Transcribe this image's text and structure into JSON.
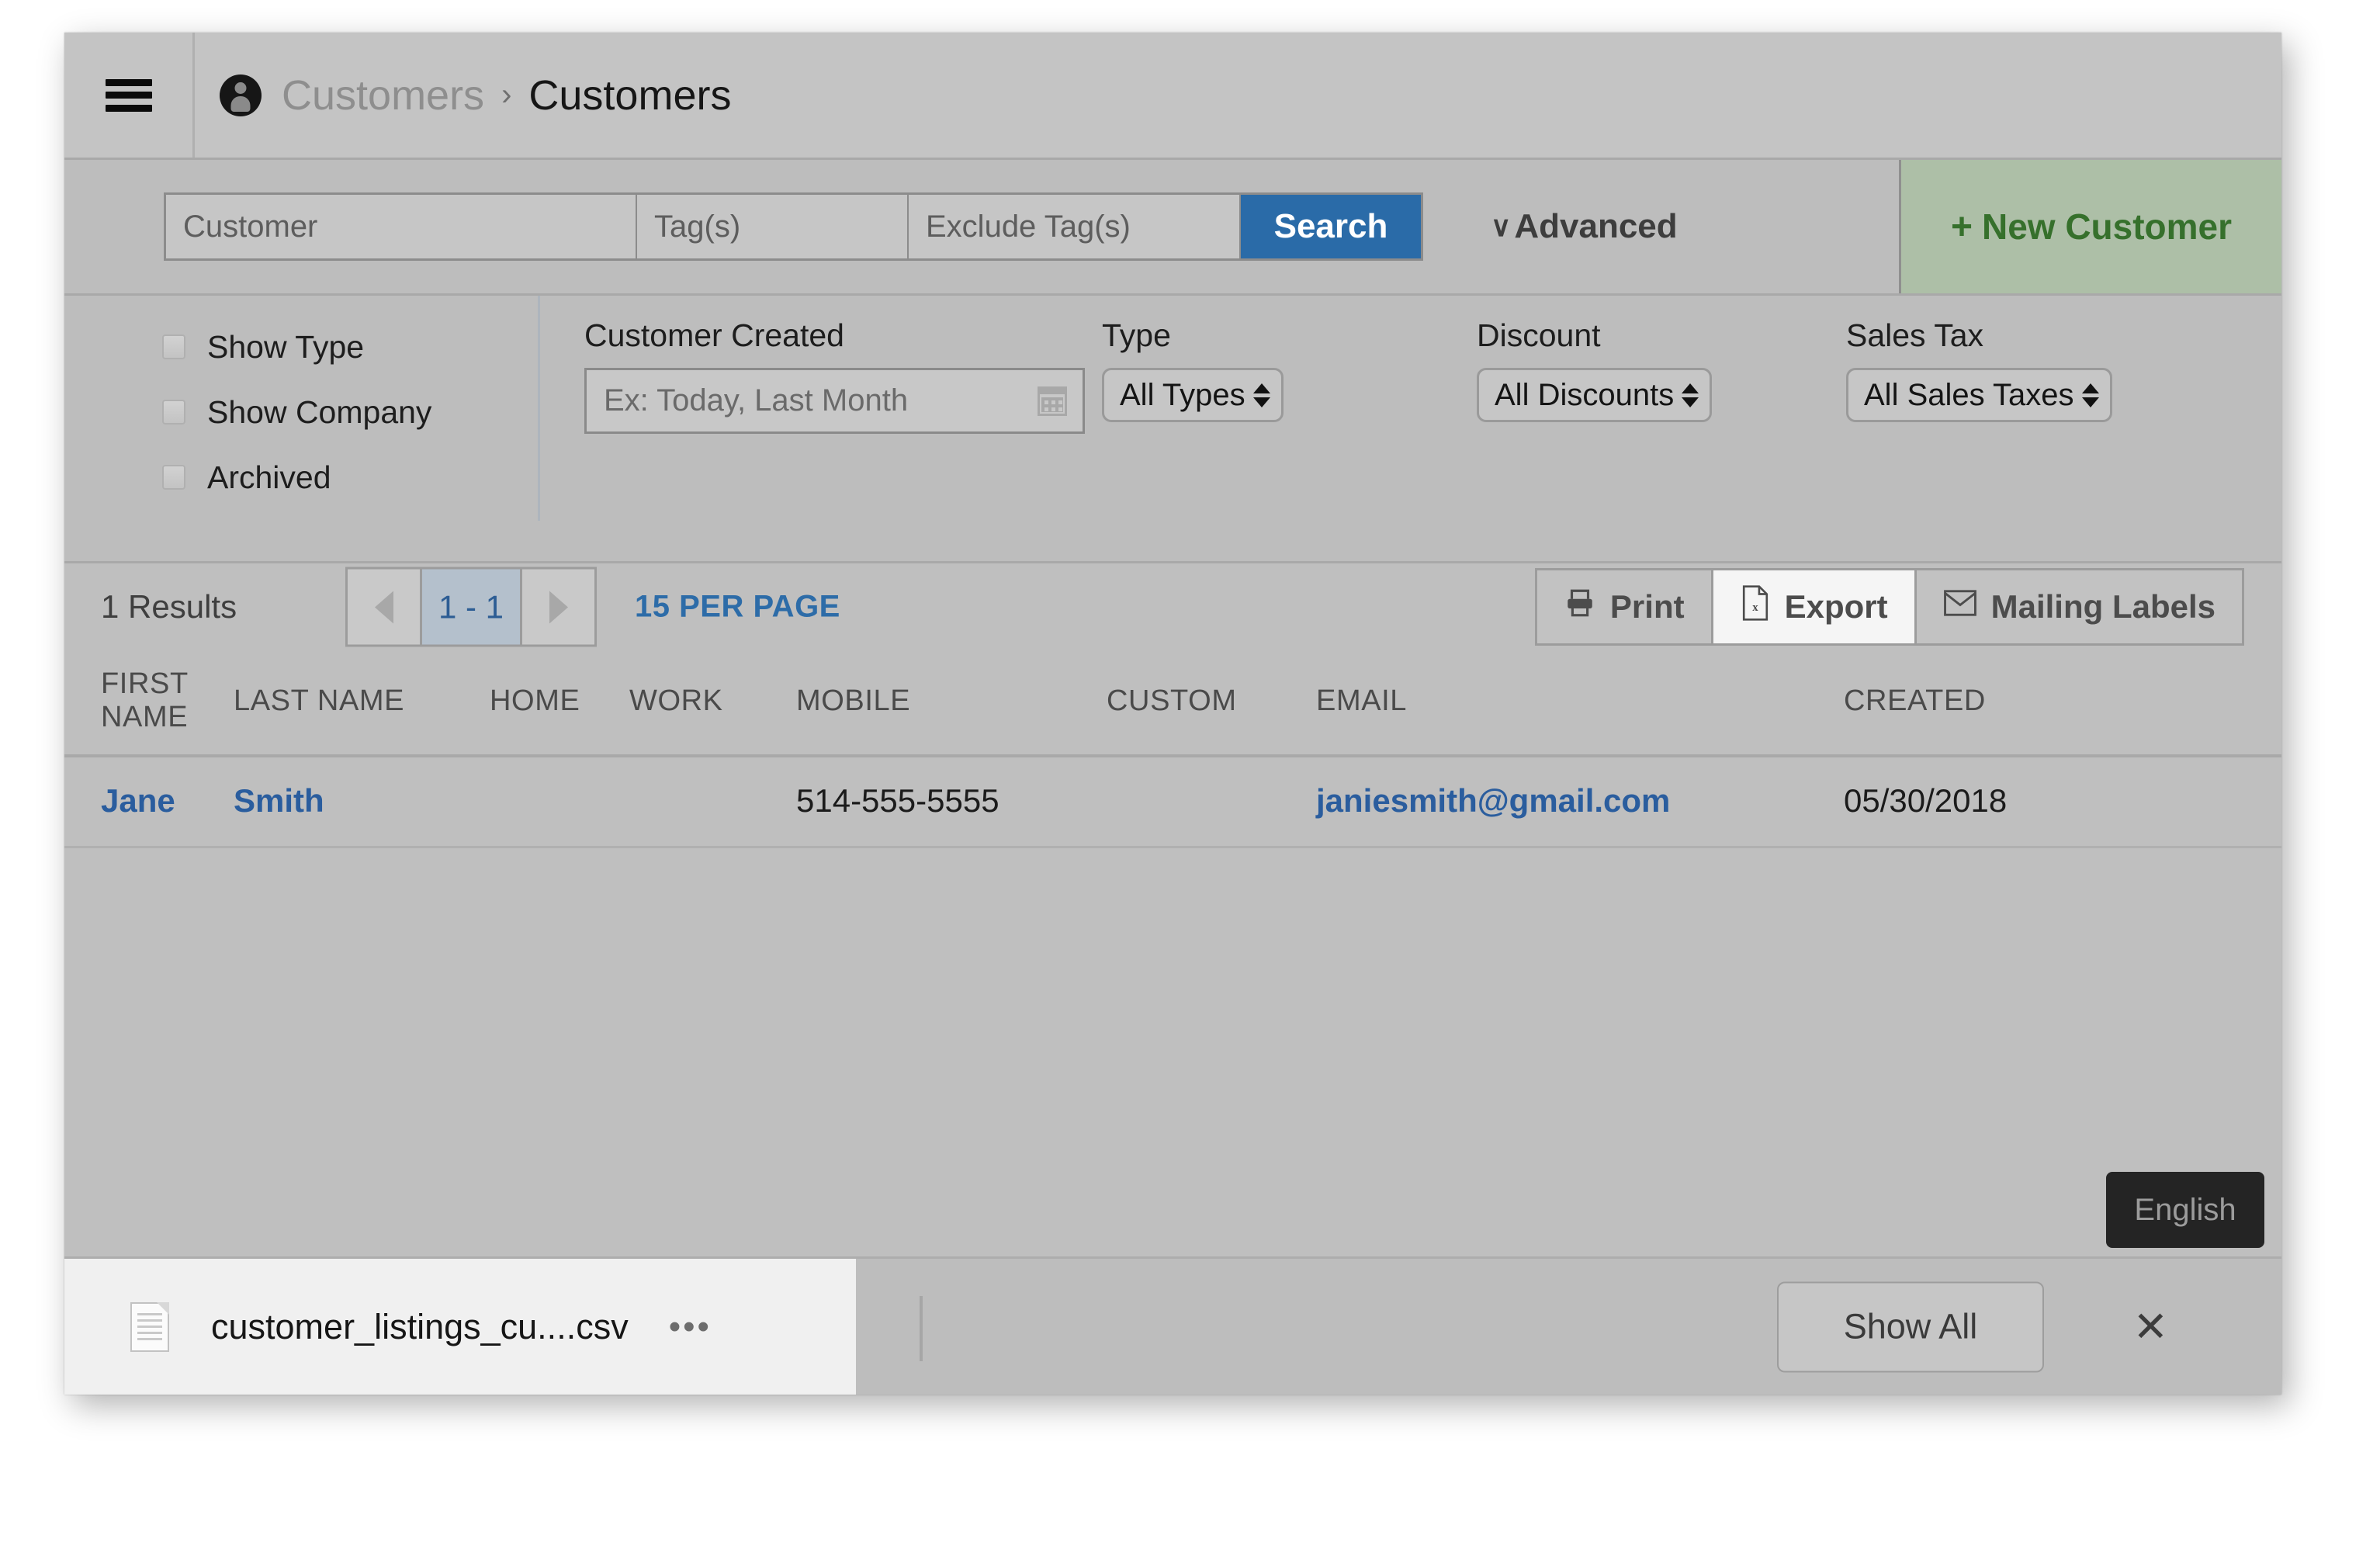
{
  "window": {
    "hamburger_label": "menu"
  },
  "header": {
    "breadcrumb_icon": "user-circle-icon",
    "breadcrumb_parent": "Customers",
    "breadcrumb_separator": "›",
    "breadcrumb_current": "Customers"
  },
  "search": {
    "customer_placeholder": "Customer",
    "customer_value": "",
    "tags_placeholder": "Tag(s)",
    "tags_value": "",
    "exclude_tags_placeholder": "Exclude Tag(s)",
    "exclude_tags_value": "",
    "search_label": "Search",
    "advanced_label": "Advanced",
    "advanced_chevron": "∨",
    "new_customer_label": "New Customer",
    "new_customer_plus": "+",
    "accent_blue": "#2a6ba8",
    "new_customer_green": "#36702c"
  },
  "filters": {
    "checkboxes": [
      {
        "label": "Show Type",
        "checked": false
      },
      {
        "label": "Show Company",
        "checked": false
      },
      {
        "label": "Archived",
        "checked": false
      }
    ],
    "customer_created": {
      "label": "Customer Created",
      "placeholder": "Ex: Today, Last Month",
      "value": "",
      "icon": "calendar-icon"
    },
    "type": {
      "label": "Type",
      "value": "All Types"
    },
    "discount": {
      "label": "Discount",
      "value": "All Discounts"
    },
    "sales_tax": {
      "label": "Sales Tax",
      "value": "All Sales Taxes"
    }
  },
  "results": {
    "count_label": "1 Results",
    "page_range": "1 - 1",
    "per_page_label": "15 PER PAGE",
    "prev_icon": "chevron-left-icon",
    "next_icon": "chevron-right-icon",
    "actions": [
      {
        "label": "Print",
        "icon": "printer-icon",
        "active": false
      },
      {
        "label": "Export",
        "icon": "file-excel-icon",
        "active": true
      },
      {
        "label": "Mailing Labels",
        "icon": "envelope-icon",
        "active": false
      }
    ]
  },
  "table": {
    "columns": [
      "FIRST NAME",
      "LAST NAME",
      "HOME",
      "WORK",
      "MOBILE",
      "CUSTOM",
      "EMAIL",
      "CREATED"
    ],
    "rows": [
      {
        "first_name": "Jane",
        "last_name": "Smith",
        "home": "",
        "work": "",
        "mobile": "514-555-5555",
        "custom": "",
        "email": "janiesmith@gmail.com",
        "created": "05/30/2018"
      }
    ]
  },
  "language_badge": {
    "label": "English"
  },
  "downloads": {
    "file_name": "customer_listings_cu....csv",
    "file_icon": "csv-file-icon",
    "more_icon": "•••",
    "show_all_label": "Show All",
    "close_icon": "✕"
  }
}
